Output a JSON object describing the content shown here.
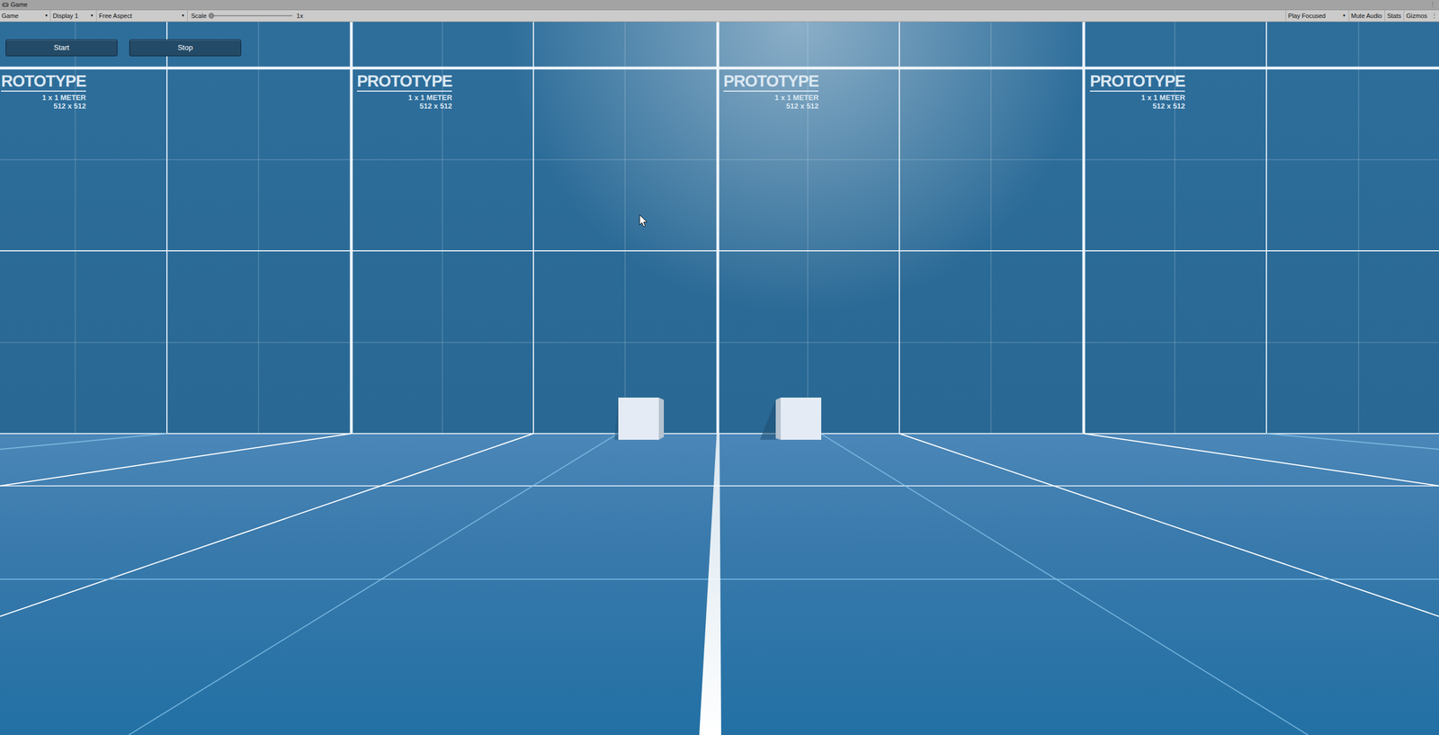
{
  "window": {
    "title": "Game"
  },
  "toolbar": {
    "view": "Game",
    "display": "Display 1",
    "aspect": "Free Aspect",
    "scale_label": "Scale",
    "scale": {
      "level": 0.0,
      "reading": "1x"
    },
    "play_mode": "Play Focused",
    "toggles": [
      {
        "label": "Mute Audio",
        "on": false
      },
      {
        "label": "Stats",
        "on": false
      },
      {
        "label": "Gizmos",
        "on": false
      }
    ]
  },
  "buttons": [
    "Start",
    "Stop"
  ],
  "wall_labels": [
    {
      "title": "ROTOTYPE",
      "size": "1 x 1 METER",
      "resolution": "512 x 512"
    },
    {
      "title": "PROTOTYPE",
      "size": "1 x 1 METER",
      "resolution": "512 x 512"
    },
    {
      "title": "PROTOTYPE",
      "size": "1 x 1 METER",
      "resolution": "512 x 512"
    },
    {
      "title": "PROTOTYPE",
      "size": "1 x 1 METER",
      "resolution": "512 x 512"
    }
  ]
}
